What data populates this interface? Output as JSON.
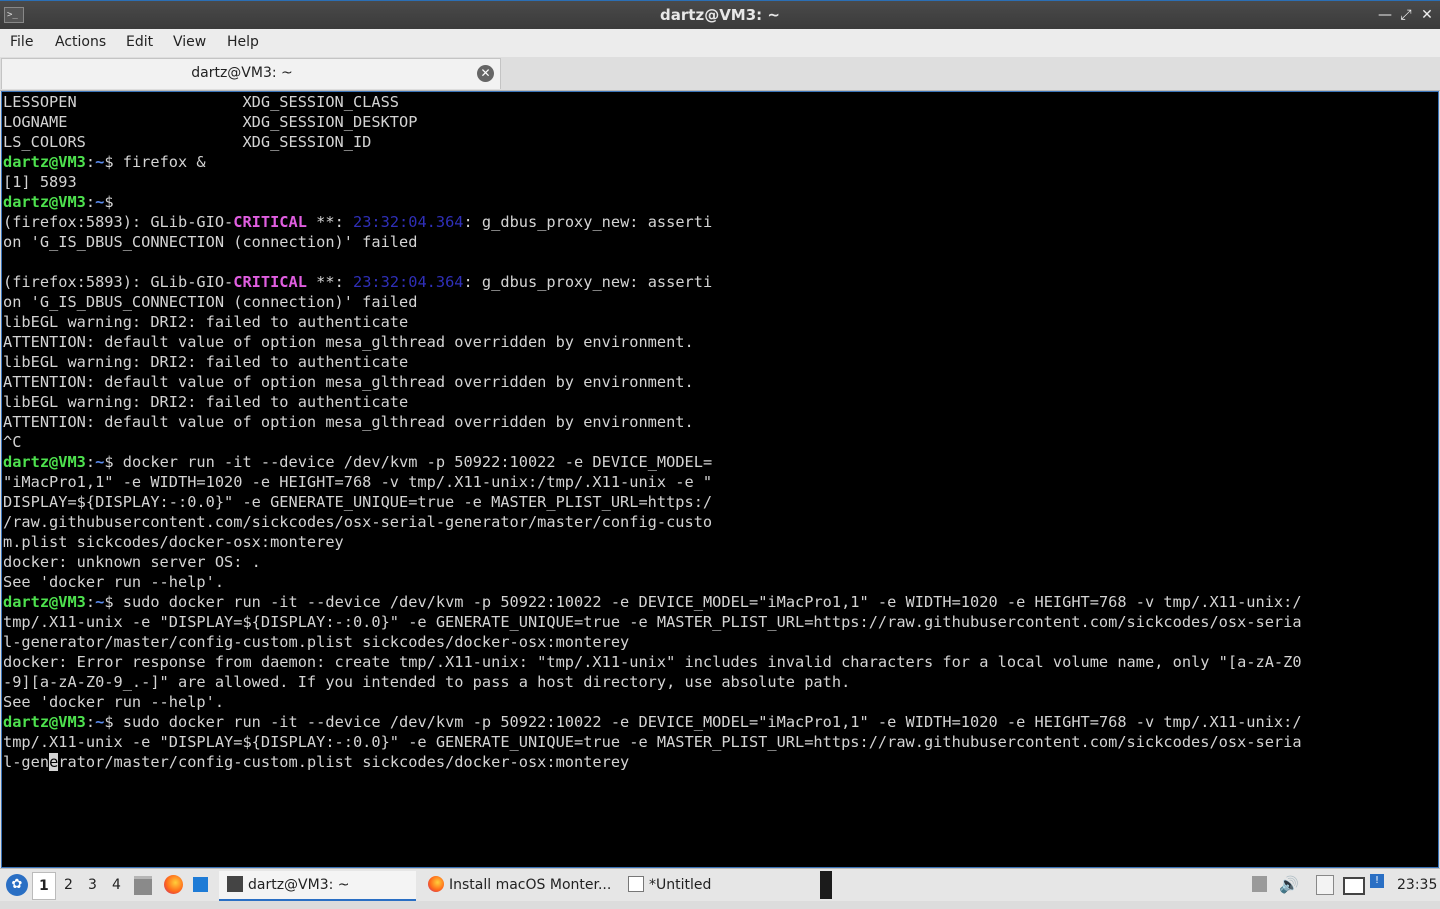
{
  "window": {
    "title": "dartz@VM3: ~",
    "app_icon": "terminal-icon",
    "controls": [
      "minimize-icon",
      "maximize-icon",
      "close-icon"
    ]
  },
  "menu": [
    "File",
    "Actions",
    "Edit",
    "View",
    "Help"
  ],
  "tab": {
    "title": "dartz@VM3: ~",
    "close_icon": "close-icon"
  },
  "terminal": {
    "lines": [
      [
        {
          "t": "LESSOPEN                  XDG_SESSION_CLASS"
        }
      ],
      [
        {
          "t": "LOGNAME                   XDG_SESSION_DESKTOP"
        }
      ],
      [
        {
          "t": "LS_COLORS                 XDG_SESSION_ID"
        }
      ],
      [
        {
          "t": "dartz@VM3",
          "c": "prompt-user"
        },
        {
          "t": ":"
        },
        {
          "t": "~",
          "c": "prompt-path"
        },
        {
          "t": "$ firefox &"
        }
      ],
      [
        {
          "t": "[1] 5893"
        }
      ],
      [
        {
          "t": "dartz@VM3",
          "c": "prompt-user"
        },
        {
          "t": ":"
        },
        {
          "t": "~",
          "c": "prompt-path"
        },
        {
          "t": "$"
        }
      ],
      [
        {
          "t": "(firefox:5893): GLib-GIO-"
        },
        {
          "t": "CRITICAL",
          "c": "critical"
        },
        {
          "t": " **: "
        },
        {
          "t": "23:32:04.364",
          "c": "ts"
        },
        {
          "t": ": g_dbus_proxy_new: asserti"
        }
      ],
      [
        {
          "t": "on 'G_IS_DBUS_CONNECTION (connection)' failed"
        }
      ],
      [
        {
          "t": ""
        }
      ],
      [
        {
          "t": "(firefox:5893): GLib-GIO-"
        },
        {
          "t": "CRITICAL",
          "c": "critical"
        },
        {
          "t": " **: "
        },
        {
          "t": "23:32:04.364",
          "c": "ts"
        },
        {
          "t": ": g_dbus_proxy_new: asserti"
        }
      ],
      [
        {
          "t": "on 'G_IS_DBUS_CONNECTION (connection)' failed"
        }
      ],
      [
        {
          "t": "libEGL warning: DRI2: failed to authenticate"
        }
      ],
      [
        {
          "t": "ATTENTION: default value of option mesa_glthread overridden by environment."
        }
      ],
      [
        {
          "t": "libEGL warning: DRI2: failed to authenticate"
        }
      ],
      [
        {
          "t": "ATTENTION: default value of option mesa_glthread overridden by environment."
        }
      ],
      [
        {
          "t": "libEGL warning: DRI2: failed to authenticate"
        }
      ],
      [
        {
          "t": "ATTENTION: default value of option mesa_glthread overridden by environment."
        }
      ],
      [
        {
          "t": "^C"
        }
      ],
      [
        {
          "t": "dartz@VM3",
          "c": "prompt-user"
        },
        {
          "t": ":"
        },
        {
          "t": "~",
          "c": "prompt-path"
        },
        {
          "t": "$ docker run -it --device /dev/kvm -p 50922:10022 -e DEVICE_MODEL="
        }
      ],
      [
        {
          "t": "\"iMacPro1,1\" -e WIDTH=1020 -e HEIGHT=768 -v tmp/.X11-unix:/tmp/.X11-unix -e \""
        }
      ],
      [
        {
          "t": "DISPLAY=${DISPLAY:-:0.0}\" -e GENERATE_UNIQUE=true -e MASTER_PLIST_URL=https:/"
        }
      ],
      [
        {
          "t": "/raw.githubusercontent.com/sickcodes/osx-serial-generator/master/config-custo"
        }
      ],
      [
        {
          "t": "m.plist sickcodes/docker-osx:monterey"
        }
      ],
      [
        {
          "t": "docker: unknown server OS: ."
        }
      ],
      [
        {
          "t": "See 'docker run --help'."
        }
      ],
      [
        {
          "t": "dartz@VM3",
          "c": "prompt-user"
        },
        {
          "t": ":"
        },
        {
          "t": "~",
          "c": "prompt-path"
        },
        {
          "t": "$ sudo docker run -it --device /dev/kvm -p 50922:10022 -e DEVICE_MODEL=\"iMacPro1,1\" -e WIDTH=1020 -e HEIGHT=768 -v tmp/.X11-unix:/"
        }
      ],
      [
        {
          "t": "tmp/.X11-unix -e \"DISPLAY=${DISPLAY:-:0.0}\" -e GENERATE_UNIQUE=true -e MASTER_PLIST_URL=https://raw.githubusercontent.com/sickcodes/osx-seria"
        }
      ],
      [
        {
          "t": "l-generator/master/config-custom.plist sickcodes/docker-osx:monterey"
        }
      ],
      [
        {
          "t": "docker: Error response from daemon: create tmp/.X11-unix: \"tmp/.X11-unix\" includes invalid characters for a local volume name, only \"[a-zA-Z0"
        }
      ],
      [
        {
          "t": "-9][a-zA-Z0-9_.-]\" are allowed. If you intended to pass a host directory, use absolute path."
        }
      ],
      [
        {
          "t": "See 'docker run --help'."
        }
      ],
      [
        {
          "t": "dartz@VM3",
          "c": "prompt-user"
        },
        {
          "t": ":"
        },
        {
          "t": "~",
          "c": "prompt-path"
        },
        {
          "t": "$ sudo docker run -it --device /dev/kvm -p 50922:10022 -e DEVICE_MODEL=\"iMacPro1,1\" -e WIDTH=1020 -e HEIGHT=768 -v tmp/.X11-unix:/"
        }
      ],
      [
        {
          "t": "tmp/.X11-unix -e \"DISPLAY=${DISPLAY:-:0.0}\" -e GENERATE_UNIQUE=true -e MASTER_PLIST_URL=https://raw.githubusercontent.com/sickcodes/osx-seria"
        }
      ],
      [
        {
          "t": "l-gen"
        },
        {
          "t": "e",
          "c": "cursor"
        },
        {
          "t": "rator/master/config-custom.plist sickcodes/docker-osx:monterey"
        }
      ]
    ]
  },
  "taskbar": {
    "start_icon": "start-menu-icon",
    "workspaces": [
      "1",
      "2",
      "3",
      "4"
    ],
    "launchers": [
      "file-manager-icon",
      "firefox-icon",
      "desktop-icon"
    ],
    "tasks": [
      {
        "label": "dartz@VM3: ~",
        "icon": "terminal-icon"
      },
      {
        "label": "Install macOS Monter...",
        "icon": "firefox-icon"
      },
      {
        "label": "*Untitled",
        "icon": "text-editor-icon"
      }
    ],
    "tray": [
      "removable-drive-icon",
      "volume-icon",
      "clipboard-icon",
      "network-icon",
      "notification-icon"
    ],
    "clock": "23:35"
  }
}
